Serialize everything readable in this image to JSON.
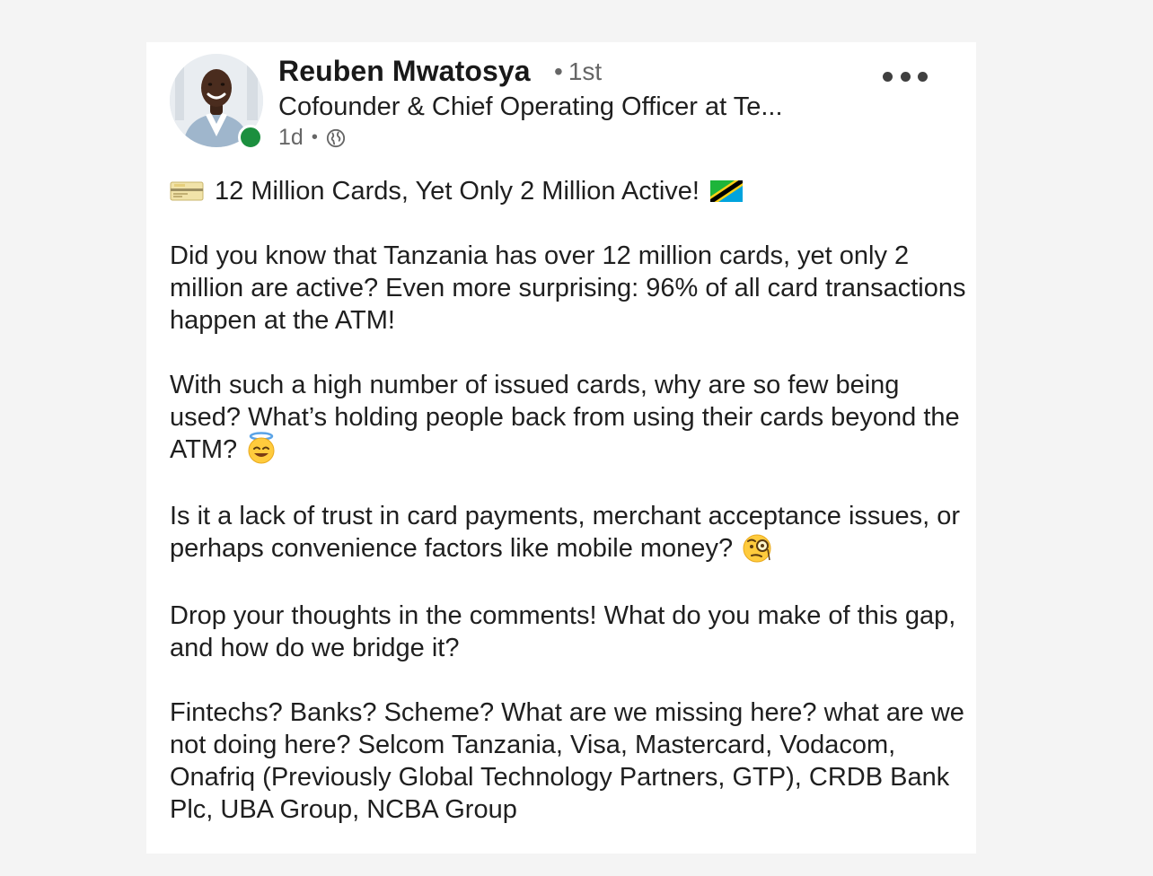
{
  "post": {
    "author": {
      "name": "Reuben Mwatosya",
      "connection_degree": "1st",
      "headline": "Cofounder & Chief Operating Officer at Te...",
      "posted_ago": "1d",
      "visibility_icon": "globe-icon",
      "online_status_color": "#1b8f3e"
    },
    "menu_icon": "more-options-icon",
    "title": "12 Million Cards, Yet Only 2 Million Active!",
    "title_icons": {
      "leading": "credit-card-icon",
      "trailing": "tanzania-flag-icon"
    },
    "paragraphs": [
      "Did you know that Tanzania has over 12 million cards, yet only 2 million are active? Even more surprising: 96% of all card transactions happen at the ATM!",
      "With such a high number of issued cards, why are so few being used? What’s holding people back from using their cards beyond the ATM?",
      "Is it a lack of trust in card payments, merchant acceptance issues, or perhaps convenience factors like mobile money?",
      "Drop your thoughts in the comments! What do you make of this gap, and how do we bridge it?",
      "Fintechs? Banks? Scheme? What are we missing here? what are we not doing here? Selcom Tanzania, Visa, Mastercard, Vodacom, Onafriq (Previously Global Technology Partners, GTP), CRDB Bank Plc, UBA Group, NCBA Group"
    ],
    "paragraph_emojis": {
      "p2": "smiling-face-with-halo-icon",
      "p3": "face-with-monocle-icon"
    }
  }
}
